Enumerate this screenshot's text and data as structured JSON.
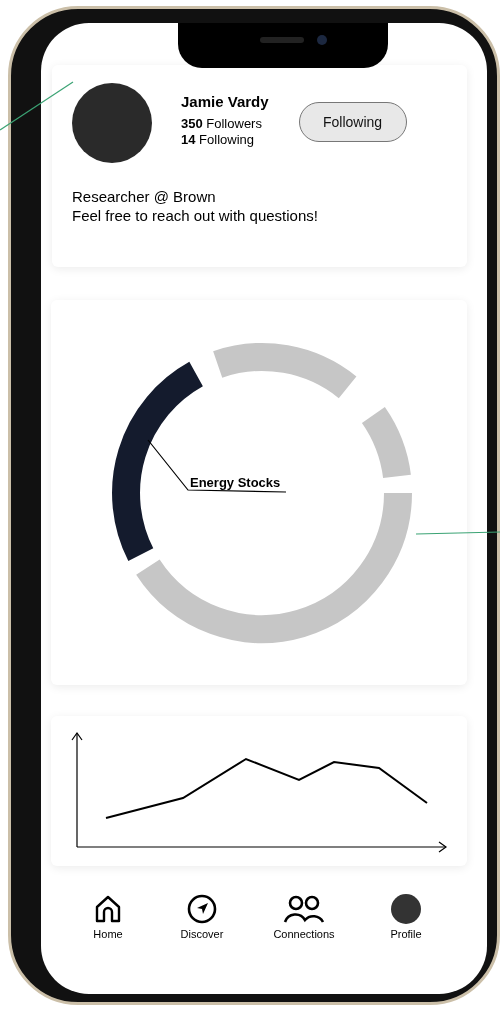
{
  "profile": {
    "name": "Jamie Vardy",
    "followers": "**350** Followers",
    "following": "**14** Following",
    "follow_button": "Following",
    "bio": [
      "Researcher @ Brown",
      "Feel free to reach out with questions!"
    ]
  },
  "donut": {
    "label": "Energy Stocks",
    "segments": [
      {
        "selected": true
      },
      {
        "selected": false
      },
      {
        "selected": false
      },
      {
        "selected": false
      }
    ]
  },
  "nav": [
    {
      "label": "Home",
      "kind": "home"
    },
    {
      "label": "Discover",
      "kind": "compass"
    },
    {
      "label": "Connections",
      "kind": "people"
    },
    {
      "label": "Profile",
      "kind": "avatar"
    }
  ]
}
